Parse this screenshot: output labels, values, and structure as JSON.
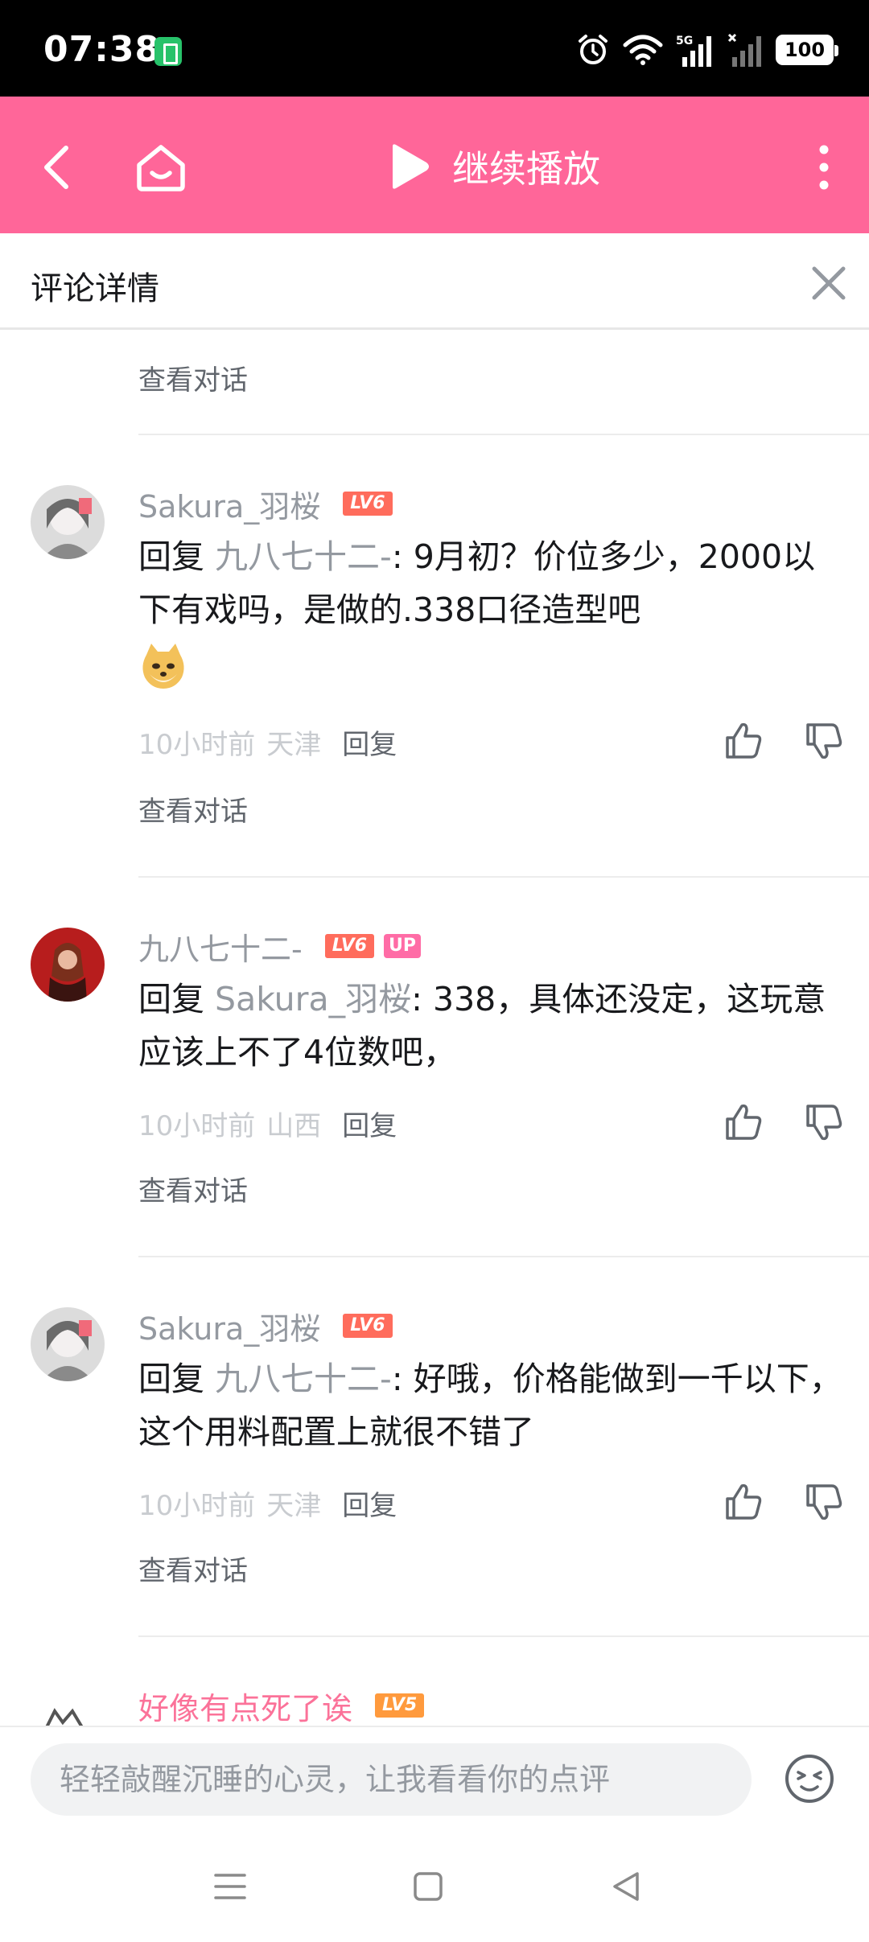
{
  "status_bar": {
    "time": "07:38",
    "battery": "100",
    "network": "5G"
  },
  "header": {
    "continue_label": "继续播放",
    "accent_color": "#ff6699"
  },
  "panel": {
    "title": "评论详情"
  },
  "view_conversation_label": "查看对话",
  "comments": [
    {
      "user": "Sakura_羽桜",
      "level": "LV6",
      "reply_prefix": "回复 ",
      "reply_to": "九八七十二-",
      "text": ": 9月初？价位多少，2000以下有戏吗，是做的.338口径造型吧",
      "time": "10小时前",
      "location": "天津",
      "reply_label": "回复",
      "has_emoji": "doge"
    },
    {
      "user": "九八七十二-",
      "level": "LV6",
      "up_badge": "UP",
      "reply_prefix": "回复 ",
      "reply_to": "Sakura_羽桜",
      "text": ": 338，具体还没定，这玩意应该上不了4位数吧，",
      "time": "10小时前",
      "location": "山西",
      "reply_label": "回复"
    },
    {
      "user": "Sakura_羽桜",
      "level": "LV6",
      "reply_prefix": "回复 ",
      "reply_to": "九八七十二-",
      "text": ": 好哦，价格能做到一千以下，这个用料配置上就很不错了",
      "time": "10小时前",
      "location": "天津",
      "reply_label": "回复"
    },
    {
      "user": "好像有点死了诶",
      "level": "LV5"
    }
  ],
  "input": {
    "placeholder": "轻轻敲醒沉睡的心灵，让我看看你的点评"
  }
}
